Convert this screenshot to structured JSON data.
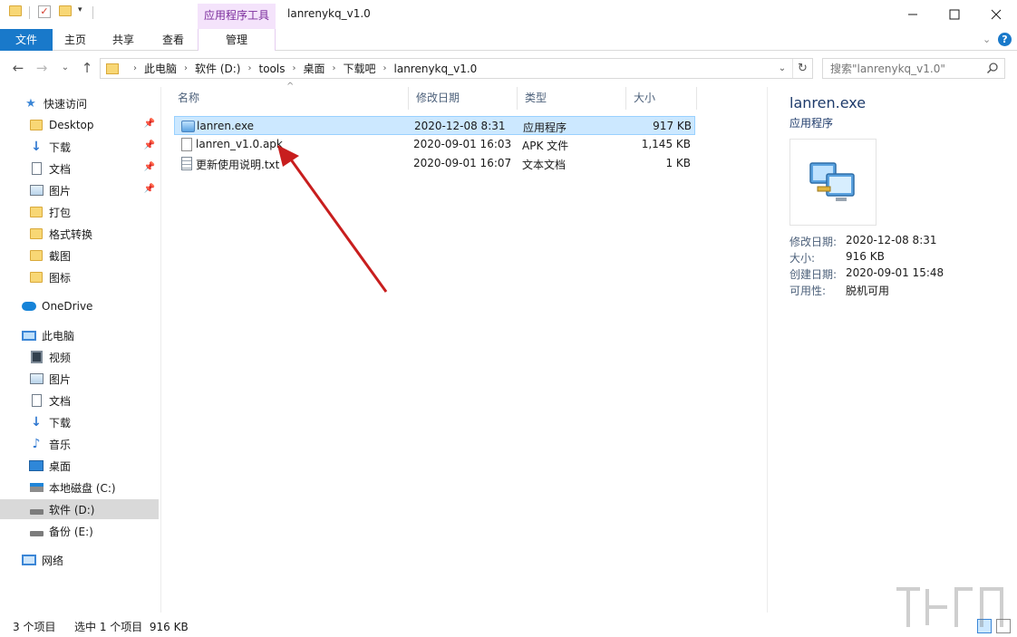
{
  "window": {
    "title": "lanrenykq_v1.0",
    "context_header": "应用程序工具",
    "minimize_icon": "minimize-icon",
    "maximize_icon": "maximize-icon",
    "close_icon": "close-icon"
  },
  "ribbon": {
    "tabs": [
      "文件",
      "主页",
      "共享",
      "查看",
      "管理"
    ],
    "collapse_icon": "chevron-down-icon",
    "help_label": "?"
  },
  "address": {
    "crumbs": [
      "此电脑",
      "软件 (D:)",
      "tools",
      "桌面",
      "下载吧",
      "lanrenykq_v1.0"
    ]
  },
  "search": {
    "placeholder": "搜索\"lanrenykq_v1.0\""
  },
  "navpane": {
    "quick_access": "快速访问",
    "quick_items": [
      "Desktop",
      "下载",
      "文档",
      "图片",
      "打包",
      "格式转换",
      "截图",
      "图标"
    ],
    "onedrive": "OneDrive",
    "this_pc": "此电脑",
    "pc_items": [
      "视频",
      "图片",
      "文档",
      "下载",
      "音乐",
      "桌面",
      "本地磁盘 (C:)",
      "软件 (D:)",
      "备份 (E:)"
    ],
    "network": "网络"
  },
  "filelist": {
    "columns": [
      "名称",
      "修改日期",
      "类型",
      "大小"
    ],
    "rows": [
      {
        "name": "lanren.exe",
        "date": "2020-12-08 8:31",
        "type": "应用程序",
        "size": "917 KB"
      },
      {
        "name": "lanren_v1.0.apk",
        "date": "2020-09-01 16:03",
        "type": "APK 文件",
        "size": "1,145 KB"
      },
      {
        "name": "更新使用说明.txt",
        "date": "2020-09-01 16:07",
        "type": "文本文档",
        "size": "1 KB"
      }
    ]
  },
  "details": {
    "name": "lanren.exe",
    "type": "应用程序",
    "props": [
      {
        "label": "修改日期:",
        "value": "2020-12-08 8:31"
      },
      {
        "label": "大小:",
        "value": "916 KB"
      },
      {
        "label": "创建日期:",
        "value": "2020-09-01 15:48"
      },
      {
        "label": "可用性:",
        "value": "脱机可用"
      }
    ]
  },
  "status": {
    "count": "3 个项目",
    "selection": "选中 1 个项目  916 KB"
  },
  "colors": {
    "accent": "#1979ca",
    "selection": "#cce8ff",
    "context_tab": "#f4e3fb",
    "annotation_arrow": "#c81e1e"
  }
}
